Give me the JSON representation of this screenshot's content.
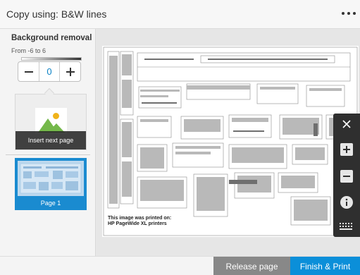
{
  "header": {
    "title": "Copy using: B&W lines",
    "menu_icon": "more-horizontal-icon"
  },
  "background_removal": {
    "label": "Background removal",
    "range": "From -6 to 6",
    "value": "0",
    "decrement_icon": "minus-icon",
    "increment_icon": "plus-icon"
  },
  "insert_card": {
    "label": "Insert next page",
    "icon": "image-placeholder-icon"
  },
  "pages": [
    {
      "label": "Page 1",
      "selected": true
    }
  ],
  "preview": {
    "caption_line1": "This image was printed on:",
    "caption_line2": "HP PageWide XL printers"
  },
  "zoom_toolbar": {
    "close_icon": "close-icon",
    "zoom_in_icon": "zoom-in-icon",
    "zoom_out_icon": "zoom-out-icon",
    "info_icon": "info-icon",
    "keyboard_icon": "keyboard-icon"
  },
  "footer": {
    "release_label": "Release page",
    "finish_label": "Finish & Print"
  },
  "colors": {
    "accent": "#0b8fd9",
    "selected_page": "#1a8bd0",
    "toolbar": "#2f2f2f",
    "secondary_button": "#888888"
  }
}
